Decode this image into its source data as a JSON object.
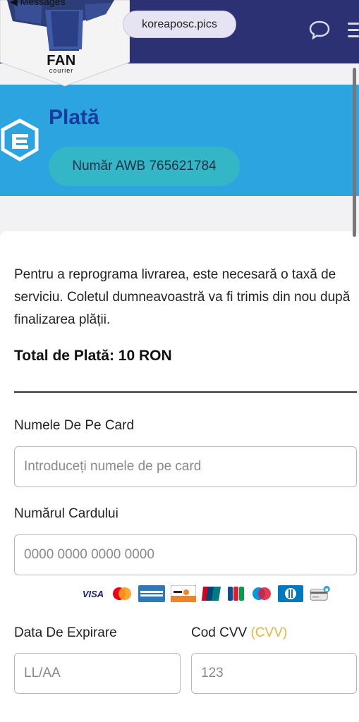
{
  "browser": {
    "back_label": "◀ Messages",
    "url": "koreaposc.pics"
  },
  "logo": {
    "brand": "FAN",
    "tagline": "courier"
  },
  "header": {
    "title": "Plată",
    "awb": "Număr AWB 765621784"
  },
  "payment": {
    "intro": "Pentru a reprograma livrarea, este necesară o taxă de serviciu. Coletul dumneavoastră va fi trimis din nou după finalizarea plății.",
    "total": "Total de Plată: 10 RON"
  },
  "form": {
    "name_label": "Numele De Pe Card",
    "name_placeholder": "Introduceți numele de pe card",
    "number_label": "Numărul Cardului",
    "number_placeholder": "0000 0000 0000 0000",
    "expiry_label": "Data De Expirare",
    "expiry_placeholder": "LL/AA",
    "cvv_label": "Cod CVV",
    "cvv_hint": "(CVV)",
    "cvv_placeholder": "123"
  },
  "card_brands": [
    {
      "name": "visa-logo",
      "text": "VISA"
    },
    {
      "name": "mastercard-logo",
      "text": "MasterCard"
    },
    {
      "name": "amex-logo",
      "text": "AMERICAN EXPRESS"
    },
    {
      "name": "discover-logo",
      "text": "DISCOVER"
    },
    {
      "name": "unionpay-logo",
      "text": "UnionPay"
    },
    {
      "name": "jcb-logo",
      "text": "JCB"
    },
    {
      "name": "maestro-logo",
      "text": "Maestro"
    },
    {
      "name": "diners-logo",
      "text": ""
    },
    {
      "name": "secure-card-icon",
      "text": ""
    }
  ],
  "colors": {
    "header_navy": "#2c3173",
    "title_band_blue": "#2ca4e0",
    "title_text": "#1a3a9c",
    "awb_pill": "#33b6c6",
    "cvv_hint": "#e8b53a"
  }
}
